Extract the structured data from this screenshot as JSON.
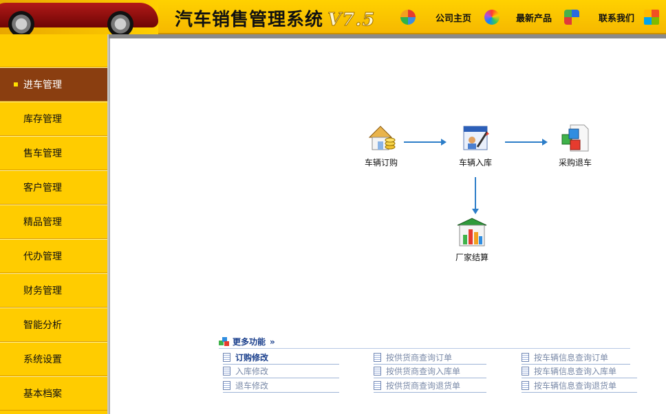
{
  "header": {
    "title": "汽车销售管理系统",
    "version": "V7.5",
    "nav": [
      {
        "label": "公司主页",
        "icon": "pie-chart-icon"
      },
      {
        "label": "最新产品",
        "icon": "color-wheel-icon"
      },
      {
        "label": "联系我们",
        "icon": "pinwheel-icon"
      }
    ]
  },
  "sidebar": {
    "items": [
      {
        "label": "进车管理",
        "active": true
      },
      {
        "label": "库存管理"
      },
      {
        "label": "售车管理"
      },
      {
        "label": "客户管理"
      },
      {
        "label": "精品管理"
      },
      {
        "label": "代办管理"
      },
      {
        "label": "财务管理"
      },
      {
        "label": "智能分析"
      },
      {
        "label": "系统设置"
      },
      {
        "label": "基本档案"
      }
    ]
  },
  "flow": {
    "nodes": [
      {
        "label": "车辆订购",
        "icon": "house-coins-icon"
      },
      {
        "label": "车辆入库",
        "icon": "warehouse-entry-icon"
      },
      {
        "label": "采购退车",
        "icon": "cubes-document-icon"
      },
      {
        "label": "厂家结算",
        "icon": "bar-chart-building-icon"
      }
    ]
  },
  "more": {
    "title": "更多功能",
    "links": [
      [
        "订购修改",
        "按供货商查询订单",
        "按车辆信息查询订单"
      ],
      [
        "入库修改",
        "按供货商查询入库单",
        "按车辆信息查询入库单"
      ],
      [
        "退车修改",
        "按供货商查询退货单",
        "按车辆信息查询退货单"
      ]
    ]
  },
  "colors": {
    "header_yellow": "#ffcc00",
    "sidebar_active": "#8a3e10",
    "link_blue": "#1a3f8c",
    "arrow_blue": "#2c7dc8"
  }
}
